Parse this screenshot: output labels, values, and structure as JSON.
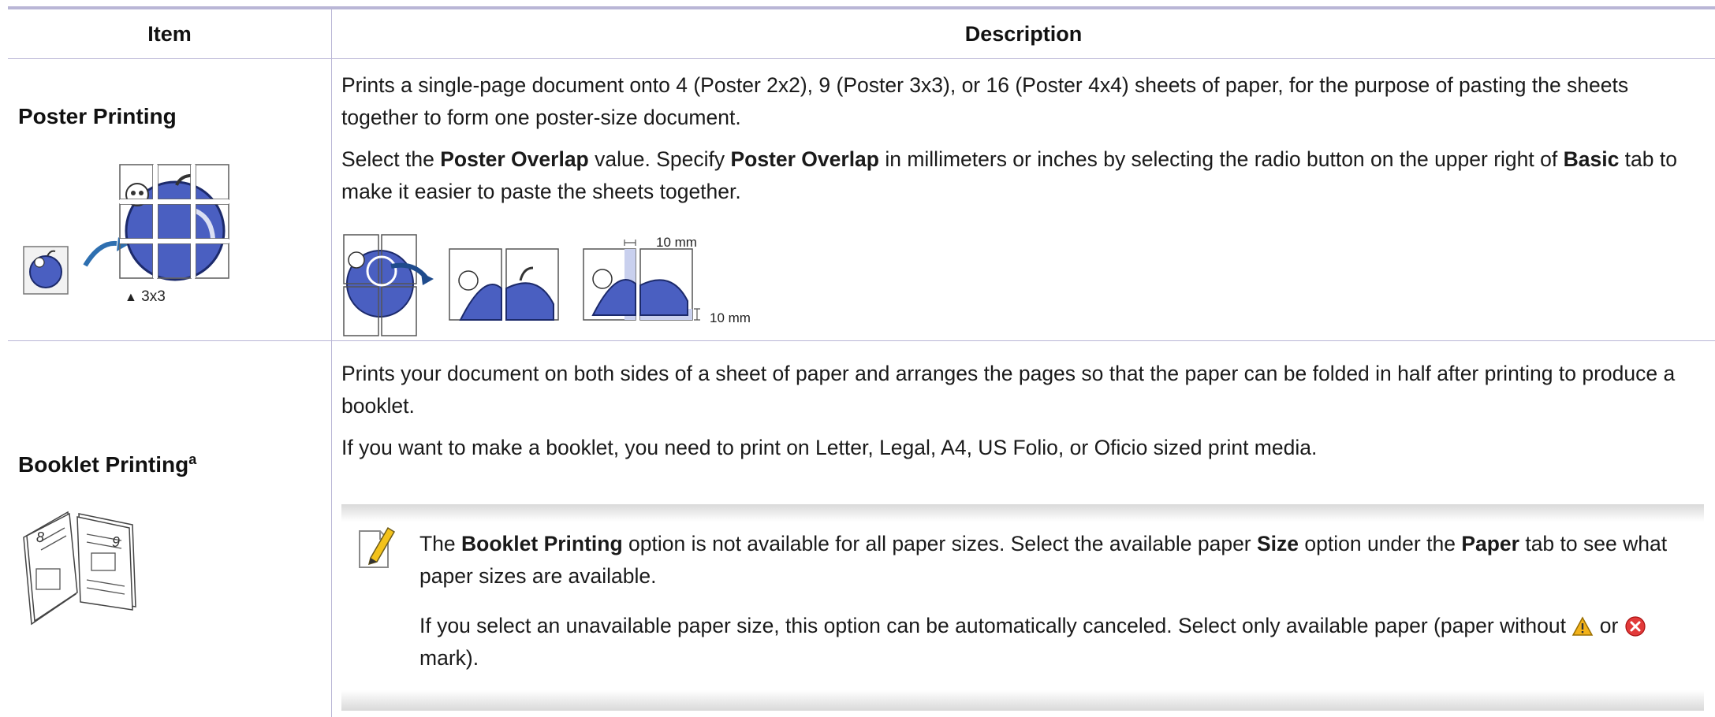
{
  "table": {
    "headers": {
      "item": "Item",
      "description": "Description"
    }
  },
  "rows": [
    {
      "label": "Poster Printing",
      "caption_symbol": "▲",
      "caption": "3x3",
      "icon": "poster-apple-icon",
      "para1": "Prints a single-page document onto 4 (Poster 2x2), 9 (Poster 3x3), or 16 (Poster 4x4) sheets of paper, for the purpose of pasting the sheets together to form one poster-size document.",
      "para2_a": "Select the ",
      "para2_b": "Poster Overlap",
      "para2_c": " value. Specify ",
      "para2_d": "Poster Overlap",
      "para2_e": " in millimeters or inches by selecting the radio button on the upper right of ",
      "para2_f": "Basic",
      "para2_g": " tab to make it easier to paste the sheets together.",
      "overlap_top": "10 mm",
      "overlap_bottom": "10 mm"
    },
    {
      "label": "Booklet Printing",
      "footnote": "a",
      "icon": "booklet-icon",
      "page_left": "8",
      "page_right": "9",
      "para1": "Prints your document on both sides of a sheet of paper and arranges the pages so that the paper can be folded in half after printing to produce a booklet.",
      "para2": "If you want to make a booklet, you need to print on Letter, Legal, A4, US Folio, or Oficio sized print media.",
      "note": {
        "icon": "pencil-note-icon",
        "line1_a": "The ",
        "line1_b": "Booklet Printing",
        "line1_c": " option is not available for all paper sizes. Select the available paper ",
        "line1_d": "Size",
        "line1_e": " option under the ",
        "line1_f": "Paper",
        "line1_g": " tab to see what paper sizes are available.",
        "line2_a": "If you select an unavailable paper size, this option can be automatically canceled. Select only available paper (paper without ",
        "line2_b": " or ",
        "line2_c": " mark).",
        "warning_icon": "warning-triangle-icon",
        "error_icon": "error-x-icon"
      }
    }
  ],
  "colors": {
    "rule": "#b9b6d6",
    "apple_blue": "#4a5fc1",
    "arrow_blue": "#2e6fb0"
  }
}
